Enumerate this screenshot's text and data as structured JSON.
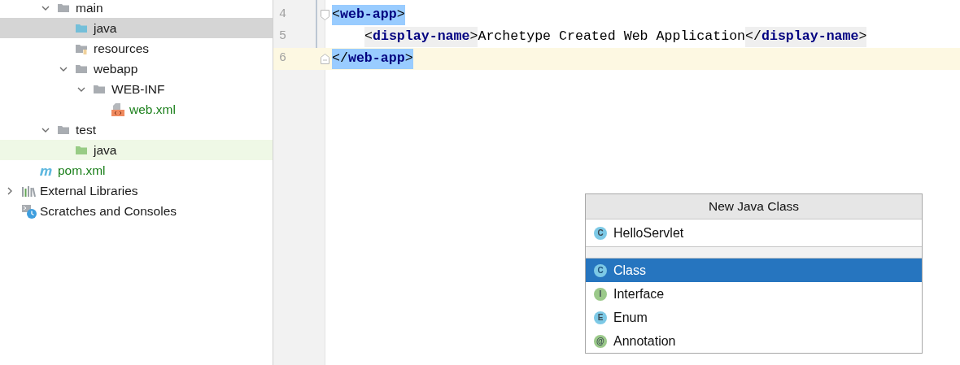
{
  "project_tree": {
    "source_folders": [
      {
        "name": "main",
        "kind": "folder",
        "expanded": true,
        "selected": false,
        "highlighted": false,
        "children": [
          {
            "name": "java",
            "kind": "source-folder",
            "selected": true
          },
          {
            "name": "resources",
            "kind": "resources-folder",
            "selected": false,
            "highlighted": false
          },
          {
            "name": "webapp",
            "kind": "folder",
            "expanded": true,
            "selected": false,
            "highlighted": false,
            "children": [
              {
                "name": "WEB-INF",
                "kind": "folder",
                "expanded": true,
                "selected": false,
                "highlighted": false,
                "children": [
                  {
                    "name": "web.xml",
                    "kind": "xml-file",
                    "selected": false,
                    "highlighted": false
                  }
                ]
              }
            ]
          }
        ]
      },
      {
        "name": "test",
        "kind": "folder",
        "expanded": true,
        "selected": false,
        "highlighted": false,
        "children": [
          {
            "name": "java",
            "kind": "test-folder",
            "selected": false,
            "highlighted": true
          }
        ]
      }
    ],
    "module_files": [
      {
        "name": "pom.xml",
        "kind": "maven-file",
        "selected": false,
        "highlighted": false
      }
    ],
    "roots": [
      {
        "name": "External Libraries",
        "kind": "libraries",
        "expanded": false,
        "selected": false,
        "highlighted": false
      },
      {
        "name": "Scratches and Consoles",
        "kind": "scratches",
        "selected": false,
        "highlighted": false
      }
    ]
  },
  "editor": {
    "lines": [
      {
        "number": "4",
        "current": false,
        "fold_start": true,
        "fold_end": false,
        "indented": false,
        "tokens": [
          {
            "kind": "tag",
            "open": "<",
            "name": "web-app",
            "close": ">",
            "matched": true
          }
        ]
      },
      {
        "number": "5",
        "current": false,
        "fold_start": false,
        "fold_end": false,
        "indented": true,
        "tokens": [
          {
            "kind": "tag",
            "open": "<",
            "name": "display-name",
            "close": ">",
            "matched": false
          },
          {
            "kind": "text",
            "text": "Archetype Created Web Application"
          },
          {
            "kind": "tag",
            "open": "</",
            "name": "display-name",
            "close": ">",
            "matched": false
          }
        ]
      },
      {
        "number": "6",
        "current": true,
        "fold_start": false,
        "fold_end": true,
        "indented": false,
        "tokens": [
          {
            "kind": "tag",
            "open": "</",
            "name": "web-app",
            "close": ">",
            "matched": true
          }
        ]
      }
    ]
  },
  "popup": {
    "title": "New Java Class",
    "name_field": {
      "value": "HelloServlet",
      "icon_letter": "C",
      "color": "#7dc9e6"
    },
    "options": [
      {
        "label": "Class",
        "icon_letter": "C",
        "color": "#7dc9e6",
        "selected": true
      },
      {
        "label": "Interface",
        "icon_letter": "I",
        "color": "#9bc98a",
        "selected": false
      },
      {
        "label": "Enum",
        "icon_letter": "E",
        "color": "#7dc9e6",
        "selected": false
      },
      {
        "label": "Annotation",
        "icon_letter": "@",
        "color": "#9bc98a",
        "selected": false
      }
    ]
  }
}
